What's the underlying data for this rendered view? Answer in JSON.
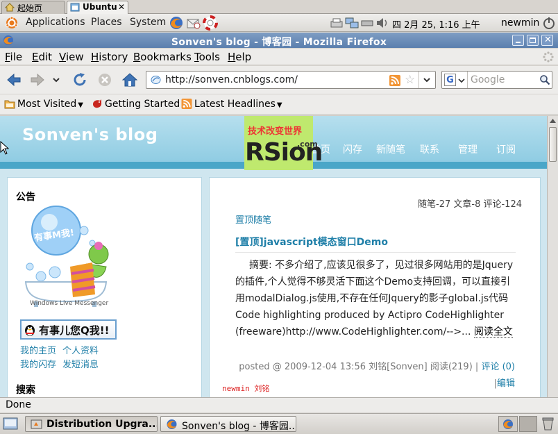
{
  "vnc_tabs": [
    {
      "label": "起始页",
      "active": false
    },
    {
      "label": "Ubuntu",
      "active": true
    }
  ],
  "gnome_panel": {
    "menus": [
      "Applications",
      "Places",
      "System"
    ],
    "clock": "四    2月 25, 1:16 上午",
    "user": "newmin"
  },
  "window": {
    "title": "Sonven's blog - 博客园 - Mozilla Firefox"
  },
  "menubar": [
    {
      "key": "F",
      "rest": "ile"
    },
    {
      "key": "E",
      "rest": "dit"
    },
    {
      "key": "V",
      "rest": "iew"
    },
    {
      "key": "H",
      "rest": "istory"
    },
    {
      "key": "B",
      "rest": "ookmarks"
    },
    {
      "key": "T",
      "rest": "ools"
    },
    {
      "key": "H",
      "rest": "elp"
    }
  ],
  "navigation": {
    "url": "http://sonven.cnblogs.com/",
    "search_placeholder": "Google"
  },
  "bookmarks": [
    {
      "label": "Most Visited",
      "icon": "folder-icon",
      "dropdown": true
    },
    {
      "label": "Getting Started",
      "icon": "firefox-bookmark-icon",
      "dropdown": false
    },
    {
      "label": "Latest Headlines",
      "icon": "rss-icon",
      "dropdown": true
    }
  ],
  "blog": {
    "title": "Sonven's blog",
    "nav": [
      "首页",
      "闪存",
      "新随笔",
      "联系",
      "管理",
      "订阅"
    ],
    "logo_tagline": "技术改变世界",
    "logo_text": "RSion",
    "logo_com": ".com"
  },
  "sidebar": {
    "notice_heading": "公告",
    "messenger_bubble": "有事M我!",
    "messenger_brand": "Windows Live Messenger",
    "qq_button": "有事儿您Q我!!",
    "links": [
      "我的主页",
      "个人资料",
      "我的闪存",
      "发短消息"
    ],
    "search_heading": "搜索"
  },
  "main": {
    "stats": "随笔-27  文章-8  评论-124",
    "category": "置顶随笔",
    "post_title": "[置顶]javascript模态窗口Demo",
    "summary": "摘要: 不多介绍了,应该见很多了，见过很多网站用的是Jquery的插件,个人觉得不够灵活下面这个Demo支持回调，可以直接引用modalDialog.js使用,不存在任何Jquery的影子global.js代码Code highlighting produced by Actipro CodeHighlighter (freeware)http://www.CodeHighlighter.com/-->...",
    "read_more": "阅读全文",
    "meta_prefix": "posted @ 2009-12-04 13:56 刘铭[Sonven] 阅读(219) |",
    "comments": "评论 (0)",
    "edit_sep": "|",
    "edit": "编辑",
    "watermark": "newmin 刘铭"
  },
  "statusbar": "Done",
  "taskbar": [
    {
      "label": "Distribution Upgra...",
      "active": true,
      "icon": "upgrade-icon"
    },
    {
      "label": "Sonven's blog - 博客园...",
      "active": false,
      "icon": "firefox-icon"
    }
  ],
  "colors": {
    "link": "#1f7fa8",
    "header": "#8dcbe2",
    "titlebar": "#5b7fae",
    "logo_bg": "#bfe96e"
  }
}
